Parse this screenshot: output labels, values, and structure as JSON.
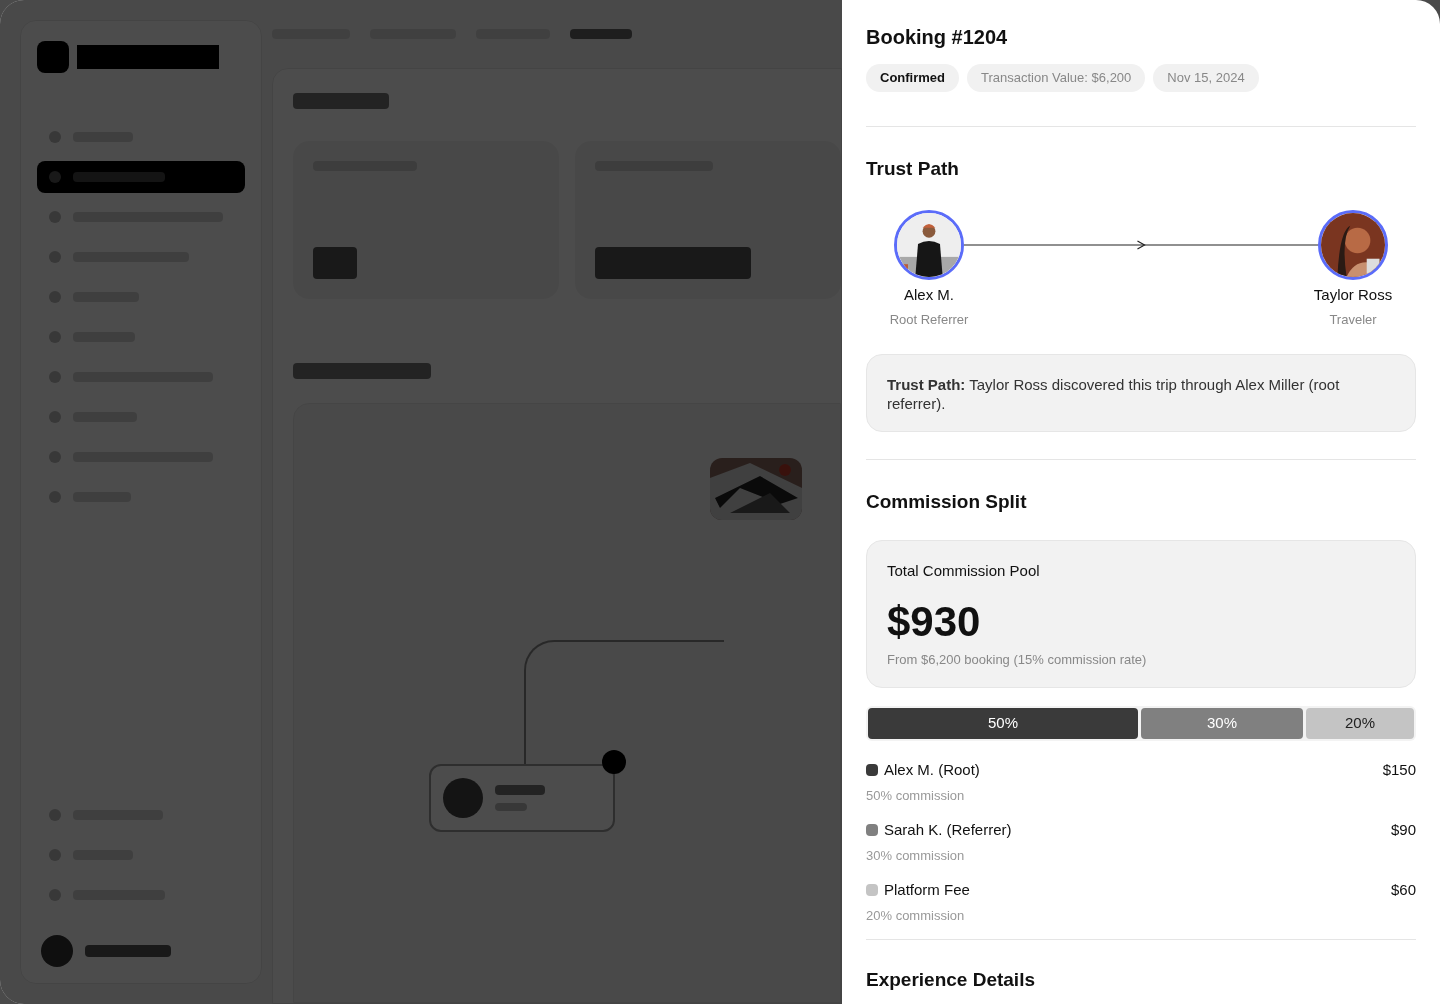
{
  "background": {
    "sidebar": {
      "items": [
        {
          "selected": false
        },
        {
          "selected": true
        },
        {
          "selected": false
        },
        {
          "selected": false
        },
        {
          "selected": false
        },
        {
          "selected": false
        },
        {
          "selected": false
        },
        {
          "selected": false
        },
        {
          "selected": false
        },
        {
          "selected": false
        }
      ]
    }
  },
  "booking": {
    "title": "Booking #1204",
    "chips": [
      {
        "label": "Confirmed",
        "kind": "status"
      },
      {
        "label": "Transaction Value: $6,200",
        "kind": "info"
      },
      {
        "label": "Nov 15, 2024",
        "kind": "info"
      }
    ],
    "trust_path": {
      "title": "Trust Path",
      "people": [
        {
          "name": "Alex M.",
          "role": "Root Referrer"
        },
        {
          "name": "Taylor Ross",
          "role": "Traveler"
        }
      ],
      "note": "**Trust Path:** Taylor Ross discovered this trip through Alex Miller (root referrer)."
    },
    "commission": {
      "title": "Commission Split",
      "pool": {
        "label": "Total Commission Pool",
        "amount": "$930",
        "detail": "From $6,200 booking (15% commission rate)"
      },
      "shares": [
        {
          "name": "Alex M. (Root)",
          "percent": "50%",
          "color": "#3a3a3a",
          "amount": "$150",
          "note": "50% commission"
        },
        {
          "name": "Sarah K. (Referrer)",
          "percent": "30%",
          "color": "#808080",
          "amount": "$90",
          "note": "30% commission"
        },
        {
          "name": "Platform Fee",
          "percent": "20%",
          "color": "#c4c4c4",
          "amount": "$60",
          "note": "20% commission"
        }
      ]
    },
    "next_section": "Experience Details"
  }
}
